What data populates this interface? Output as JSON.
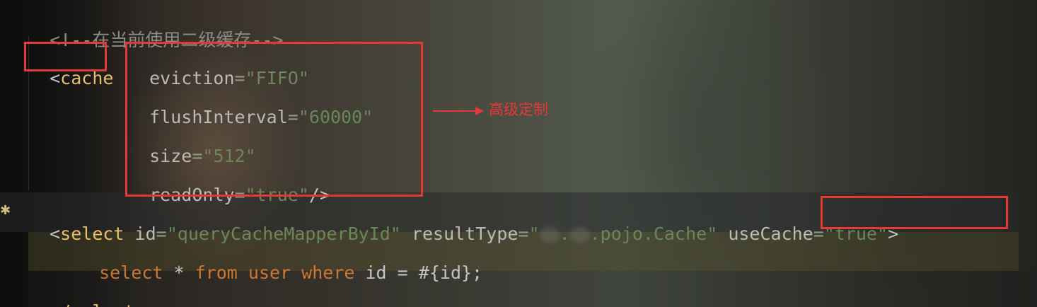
{
  "editor": {
    "comment": "<!--在当前使用二级缓存-->",
    "cache_tag": {
      "open": "<",
      "name": "cache",
      "attrs": [
        {
          "name": "eviction",
          "eq": "=",
          "value": "\"FIFO\"",
          "tail": ""
        },
        {
          "name": "flushInterval",
          "eq": "=",
          "value": "\"60000\"",
          "tail": ""
        },
        {
          "name": "size",
          "eq": "=",
          "value": "\"512\"",
          "tail": ""
        },
        {
          "name": "readOnly",
          "eq": "=",
          "value": "\"true\"",
          "tail": "/>"
        }
      ]
    },
    "select_open": {
      "open": "<",
      "name": "select",
      "id_attr": "id",
      "eq": "=",
      "id_value": "\"queryCacheMapperById\"",
      "result_attr": "resultType",
      "result_value_start": "\"",
      "result_value_mid": ".",
      "result_value_end": ".pojo.Cache\"",
      "usecache_attr": "useCache",
      "usecache_value": "\"true\"",
      "close": ">"
    },
    "query": {
      "select": "select",
      "star": "*",
      "from": "from",
      "user": "user",
      "where": "where",
      "id": "id",
      "eq": "=",
      "param": "#{id};"
    },
    "select_close": "</select>"
  },
  "annotation": {
    "label": "高级定制",
    "color": "#e53935"
  },
  "colors": {
    "highlight_box": "#e53935",
    "tag": "#e8bf6a",
    "string": "#6a8759",
    "keyword": "#cc7832",
    "comment": "#8a8f86"
  },
  "icons": {
    "gutter": "method-marker-icon"
  }
}
